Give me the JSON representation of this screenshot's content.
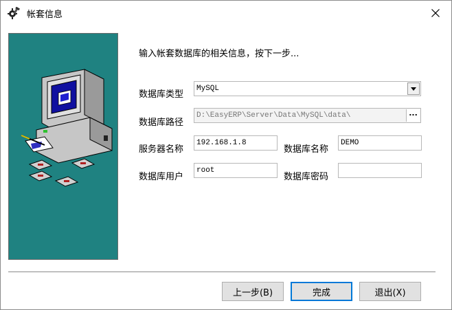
{
  "window": {
    "title": "帐套信息"
  },
  "prompt": "输入帐套数据库的相关信息，按下一步...",
  "form": {
    "db_type_label": "数据库类型",
    "db_type_value": "MySQL",
    "db_path_label": "数据库路径",
    "db_path_value": "D:\\EasyERP\\Server\\Data\\MySQL\\data\\",
    "browse_label": "...",
    "server_label": "服务器名称",
    "server_value": "192.168.1.8",
    "db_name_label": "数据库名称",
    "db_name_value": "DEMO",
    "user_label": "数据库用户",
    "user_value": "root",
    "password_label": "数据库密码",
    "password_value": ""
  },
  "buttons": {
    "prev": "上一步(B)",
    "finish": "完成",
    "exit": "退出(X)"
  },
  "icons": {
    "app": "wrench-gear-icon",
    "close": "close-icon",
    "illustration": "computer-with-floppy-disks-illustration"
  },
  "colors": {
    "panel": "#1f8281",
    "default_button_border": "#0078d7"
  }
}
